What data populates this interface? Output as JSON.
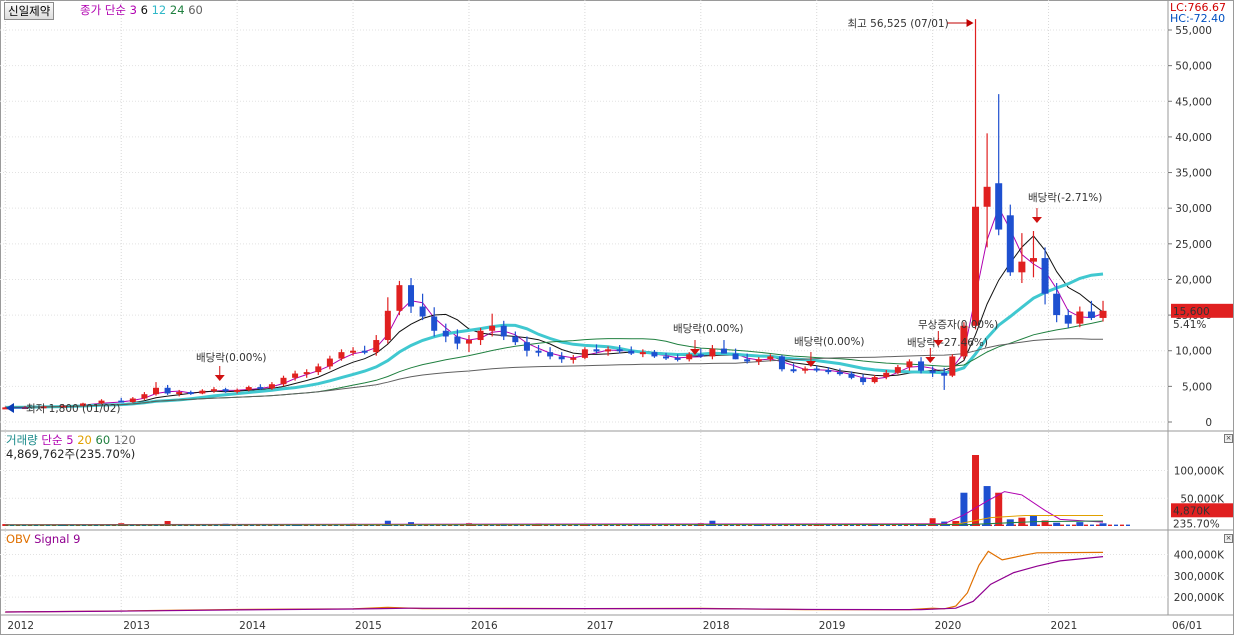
{
  "header": {
    "stock_name": "신일제약",
    "ma_title": "종가 단순",
    "ma_periods": [
      "3",
      "6",
      "12",
      "24",
      "60"
    ],
    "ma_colors": [
      "#b000b0",
      "#101010",
      "#40c8d0",
      "#208040",
      "#606060"
    ],
    "lc_label": "LC:766.67",
    "hc_label": "HC:-72.40"
  },
  "chart_data": [
    {
      "type": "candlestick",
      "title": "신일제약",
      "ylim": [
        0,
        57000
      ],
      "yticks": [
        "0",
        "5,000",
        "10,000",
        "15,000",
        "20,000",
        "25,000",
        "30,000",
        "35,000",
        "40,000",
        "45,000",
        "50,000",
        "55,000"
      ],
      "x_ticks": [
        "2012",
        "2013",
        "2014",
        "2015",
        "2016",
        "2017",
        "2018",
        "2019",
        "2020",
        "2021",
        "06/01"
      ],
      "candles": [
        [
          2012.0,
          2000,
          2150,
          1850,
          2050
        ],
        [
          2012.17,
          2050,
          2250,
          1900,
          2100
        ],
        [
          2012.33,
          2100,
          2350,
          2000,
          2200
        ],
        [
          2012.5,
          2200,
          2500,
          2050,
          2300
        ],
        [
          2012.67,
          2300,
          2700,
          2200,
          2600
        ],
        [
          2012.83,
          2600,
          3200,
          2500,
          3000
        ],
        [
          2013.0,
          3000,
          3400,
          2800,
          2800
        ],
        [
          2013.1,
          2800,
          3500,
          2700,
          3300
        ],
        [
          2013.2,
          3300,
          4200,
          3100,
          3900
        ],
        [
          2013.3,
          3900,
          5600,
          3700,
          4800
        ],
        [
          2013.4,
          4800,
          5200,
          3800,
          4000
        ],
        [
          2013.5,
          4000,
          4500,
          3600,
          4200
        ],
        [
          2013.6,
          4200,
          4400,
          3800,
          4000
        ],
        [
          2013.7,
          4000,
          4600,
          3900,
          4400
        ],
        [
          2013.8,
          4400,
          4900,
          4100,
          4600
        ],
        [
          2013.9,
          4600,
          4800,
          4100,
          4300
        ],
        [
          2014.0,
          4300,
          4700,
          4000,
          4500
        ],
        [
          2014.1,
          4500,
          5100,
          4300,
          4900
        ],
        [
          2014.2,
          4900,
          5300,
          4500,
          4700
        ],
        [
          2014.3,
          4700,
          5600,
          4500,
          5300
        ],
        [
          2014.4,
          5300,
          6500,
          5000,
          6200
        ],
        [
          2014.5,
          6200,
          7200,
          5800,
          6800
        ],
        [
          2014.6,
          6800,
          7400,
          6200,
          7000
        ],
        [
          2014.7,
          7000,
          8200,
          6600,
          7800
        ],
        [
          2014.8,
          7800,
          9300,
          7400,
          8900
        ],
        [
          2014.9,
          8900,
          10200,
          8600,
          9800
        ],
        [
          2015.0,
          9800,
          10500,
          9300,
          10000
        ],
        [
          2015.1,
          10000,
          10700,
          9500,
          9800
        ],
        [
          2015.2,
          9800,
          12200,
          9300,
          11500
        ],
        [
          2015.3,
          11500,
          17500,
          11000,
          15600
        ],
        [
          2015.4,
          15600,
          19800,
          15000,
          19200
        ],
        [
          2015.5,
          19200,
          20200,
          15300,
          16200
        ],
        [
          2015.6,
          16200,
          18000,
          14300,
          14800
        ],
        [
          2015.7,
          14800,
          16100,
          12000,
          12800
        ],
        [
          2015.8,
          12800,
          13800,
          11200,
          12000
        ],
        [
          2015.9,
          12000,
          13000,
          10200,
          11000
        ],
        [
          2016.0,
          11000,
          12200,
          9800,
          11500
        ],
        [
          2016.1,
          11500,
          13200,
          10800,
          12800
        ],
        [
          2016.2,
          12800,
          15200,
          12000,
          13500
        ],
        [
          2016.3,
          13500,
          14200,
          11500,
          12000
        ],
        [
          2016.4,
          12000,
          12700,
          10800,
          11200
        ],
        [
          2016.5,
          11200,
          12000,
          9200,
          10000
        ],
        [
          2016.6,
          10000,
          10800,
          9200,
          9800
        ],
        [
          2016.7,
          9800,
          10500,
          8800,
          9200
        ],
        [
          2016.8,
          9200,
          9800,
          8300,
          8800
        ],
        [
          2016.9,
          8800,
          9400,
          8200,
          9000
        ],
        [
          2017.0,
          9000,
          10500,
          8800,
          10200
        ],
        [
          2017.1,
          10200,
          10900,
          9600,
          9900
        ],
        [
          2017.2,
          9900,
          10600,
          9300,
          10200
        ],
        [
          2017.3,
          10200,
          10800,
          9600,
          10000
        ],
        [
          2017.4,
          10000,
          10600,
          9400,
          9600
        ],
        [
          2017.5,
          9600,
          10200,
          9100,
          9800
        ],
        [
          2017.6,
          9800,
          10100,
          9000,
          9200
        ],
        [
          2017.7,
          9200,
          9700,
          8700,
          9000
        ],
        [
          2017.8,
          9000,
          9500,
          8500,
          8800
        ],
        [
          2017.9,
          8800,
          9800,
          8500,
          9500
        ],
        [
          2018.0,
          9500,
          10300,
          9000,
          9200
        ],
        [
          2018.1,
          9200,
          10800,
          8800,
          10300
        ],
        [
          2018.2,
          10300,
          11500,
          9600,
          9600
        ],
        [
          2018.3,
          9600,
          10300,
          8800,
          8800
        ],
        [
          2018.4,
          8800,
          9600,
          8200,
          8500
        ],
        [
          2018.5,
          8500,
          9100,
          8000,
          8800
        ],
        [
          2018.6,
          8800,
          9500,
          8500,
          9200
        ],
        [
          2018.7,
          9200,
          9400,
          7100,
          7400
        ],
        [
          2018.8,
          7400,
          8200,
          6900,
          7200
        ],
        [
          2018.9,
          7200,
          7800,
          6800,
          7500
        ],
        [
          2019.0,
          7500,
          7900,
          7000,
          7300
        ],
        [
          2019.1,
          7300,
          7700,
          6700,
          7000
        ],
        [
          2019.2,
          7000,
          7500,
          6500,
          6800
        ],
        [
          2019.3,
          6800,
          7100,
          6000,
          6200
        ],
        [
          2019.4,
          6200,
          6700,
          5200,
          5600
        ],
        [
          2019.5,
          5600,
          6600,
          5400,
          6300
        ],
        [
          2019.6,
          6300,
          7300,
          6000,
          6900
        ],
        [
          2019.7,
          6900,
          8000,
          6700,
          7700
        ],
        [
          2019.8,
          7700,
          8800,
          7200,
          8500
        ],
        [
          2019.9,
          8500,
          9100,
          6800,
          7200
        ],
        [
          2020.0,
          7200,
          7800,
          6300,
          6900
        ],
        [
          2020.1,
          6900,
          7600,
          4500,
          6500
        ],
        [
          2020.17,
          6500,
          9500,
          6300,
          9200
        ],
        [
          2020.27,
          9200,
          14000,
          8800,
          13500
        ],
        [
          2020.37,
          13500,
          56525,
          13000,
          30200
        ],
        [
          2020.47,
          30200,
          40500,
          24500,
          33000
        ],
        [
          2020.57,
          33500,
          46000,
          26200,
          27000
        ],
        [
          2020.67,
          29000,
          30500,
          20500,
          21000
        ],
        [
          2020.77,
          21000,
          26500,
          19500,
          22500
        ],
        [
          2020.87,
          22500,
          26800,
          20300,
          23000
        ],
        [
          2020.97,
          23000,
          24500,
          16500,
          18000
        ],
        [
          2021.07,
          18000,
          19500,
          14000,
          15000
        ],
        [
          2021.17,
          15000,
          15800,
          13200,
          13800
        ],
        [
          2021.27,
          13800,
          16200,
          13300,
          15500
        ],
        [
          2021.37,
          15500,
          17000,
          14300,
          14600
        ],
        [
          2021.47,
          14600,
          17000,
          14100,
          15600
        ]
      ],
      "current_price_label": "15,600",
      "current_change_label": "5.41%",
      "annotations": [
        {
          "text": "최고 56,525 (07/01)",
          "color": "#c00000"
        },
        {
          "text": "최저 1,800 (01/02)",
          "color": "#0a3cb4"
        },
        {
          "text": "배당락(0.00%)",
          "color": "#222222"
        },
        {
          "text": "배당락(0.00%)",
          "color": "#222222"
        },
        {
          "text": "배당락(0.00%)",
          "color": "#222222"
        },
        {
          "text": "배당락(-27.46%)",
          "color": "#222222"
        },
        {
          "text": "무상증자(0.00%)",
          "color": "#222222"
        },
        {
          "text": "배당락(-2.71%)",
          "color": "#222222"
        }
      ]
    },
    {
      "type": "bar",
      "title": "거래량",
      "ma_title": "단순",
      "ma_periods": [
        "5",
        "20",
        "60",
        "120"
      ],
      "ma_colors": [
        "#b000b0",
        "#e0a000",
        "#208040",
        "#707070"
      ],
      "info_label": "4,869,762주(235.70%)",
      "yticks": [
        "50,000K",
        "100,000K"
      ],
      "ylim": [
        0,
        140000
      ],
      "current_label": "4,870K",
      "current_pct_label": "235.70%",
      "bars": [
        [
          2012.0,
          3500
        ],
        [
          2012.5,
          2800
        ],
        [
          2013.0,
          5000
        ],
        [
          2013.4,
          9000
        ],
        [
          2013.9,
          4000
        ],
        [
          2014.5,
          3500
        ],
        [
          2015.0,
          4000
        ],
        [
          2015.3,
          9500
        ],
        [
          2015.5,
          7000
        ],
        [
          2016.0,
          5000
        ],
        [
          2016.3,
          4000
        ],
        [
          2016.6,
          4500
        ],
        [
          2017.0,
          3000
        ],
        [
          2017.5,
          2500
        ],
        [
          2018.0,
          5000
        ],
        [
          2018.1,
          9500
        ],
        [
          2018.5,
          4000
        ],
        [
          2019.0,
          3500
        ],
        [
          2019.5,
          3000
        ],
        [
          2019.9,
          3500
        ],
        [
          2020.0,
          14000
        ],
        [
          2020.1,
          8000
        ],
        [
          2020.2,
          9000
        ],
        [
          2020.27,
          60000
        ],
        [
          2020.37,
          128000
        ],
        [
          2020.47,
          72000
        ],
        [
          2020.57,
          60000
        ],
        [
          2020.67,
          12000
        ],
        [
          2020.77,
          15000
        ],
        [
          2020.87,
          19000
        ],
        [
          2020.97,
          10000
        ],
        [
          2021.07,
          6000
        ],
        [
          2021.27,
          7000
        ],
        [
          2021.47,
          4870
        ]
      ]
    },
    {
      "type": "line",
      "title": "OBV",
      "signal_label": "Signal 9",
      "series_colors": [
        "#e07000",
        "#900090"
      ],
      "yticks": [
        "200,000K",
        "300,000K",
        "400,000K"
      ],
      "ylim": [
        130000,
        440000
      ]
    }
  ]
}
